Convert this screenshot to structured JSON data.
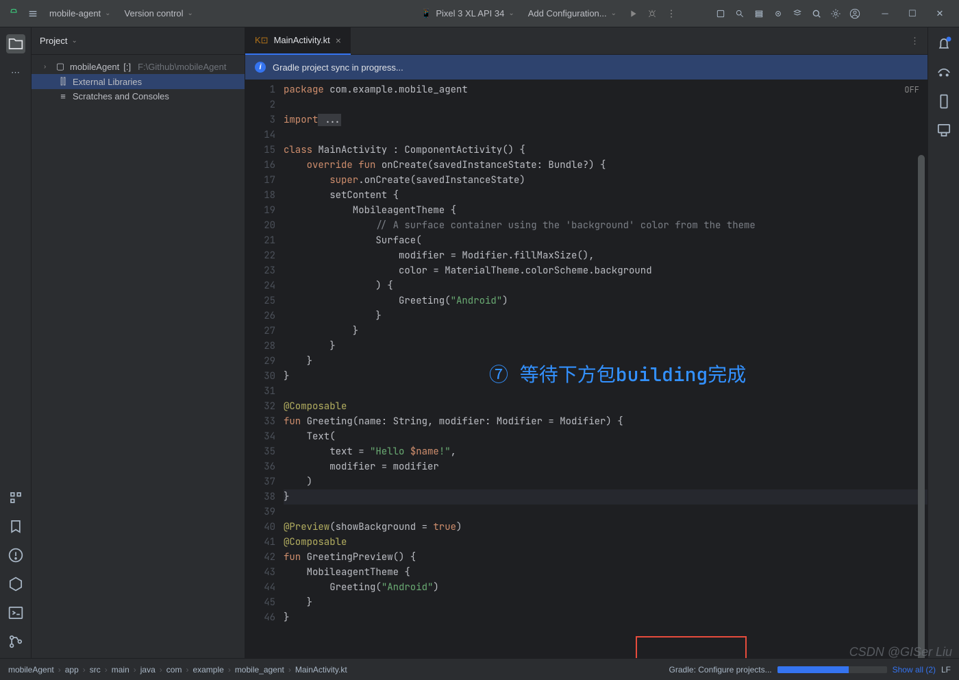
{
  "titlebar": {
    "project_name": "mobile-agent",
    "vcs_label": "Version control",
    "device_label": "Pixel 3 XL API 34",
    "run_config": "Add Configuration..."
  },
  "project_panel": {
    "title": "Project",
    "root": {
      "name": "mobileAgent",
      "branch_suffix": "[:]",
      "path": "F:\\Github\\mobileAgent"
    },
    "external_libs": "External Libraries",
    "scratches": "Scratches and Consoles"
  },
  "editor": {
    "tab_name": "MainActivity.kt",
    "notification": "Gradle project sync in progress...",
    "off_label": "OFF",
    "overlay": "⑦ 等待下方包building完成",
    "line_numbers": [
      1,
      2,
      3,
      14,
      15,
      16,
      17,
      18,
      19,
      20,
      21,
      22,
      23,
      24,
      25,
      26,
      27,
      28,
      29,
      30,
      31,
      32,
      33,
      34,
      35,
      36,
      37,
      38,
      39,
      40,
      41,
      42,
      43,
      44,
      45,
      46
    ],
    "code": {
      "l1": {
        "kw": "package",
        "rest": " com.example.mobile_agent"
      },
      "l3": {
        "kw": "import",
        "rest": " ..."
      },
      "l15": {
        "kw": "class",
        "rest": " MainActivity : ComponentActivity() {"
      },
      "l16": {
        "pre": "    ",
        "kw1": "override ",
        "kw2": "fun",
        "rest": " onCreate(savedInstanceState: Bundle?) {"
      },
      "l17": {
        "pre": "        ",
        "kw": "super",
        "rest": ".onCreate(savedInstanceState)"
      },
      "l18": "        setContent {",
      "l19": "            MobileagentTheme {",
      "l20": {
        "pre": "                ",
        "cmt": "// A surface container using the 'background' color from the theme"
      },
      "l21": "                Surface(",
      "l22": "                    modifier = Modifier.fillMaxSize(),",
      "l23": "                    color = MaterialTheme.colorScheme.background",
      "l24": "                ) {",
      "l25": {
        "pre": "                    Greeting(",
        "str": "\"Android\"",
        "rest": ")"
      },
      "l26": "                }",
      "l27": "            }",
      "l28": "        }",
      "l29": "    }",
      "l30": "}",
      "l32": {
        "ann": "@Composable"
      },
      "l33": {
        "kw": "fun",
        "rest": " Greeting(name: String, modifier: Modifier = Modifier) {"
      },
      "l34": "    Text(",
      "l35": {
        "pre": "        text = ",
        "str": "\"Hello ",
        "tmpl": "$name",
        "str2": "!\"",
        "rest": ","
      },
      "l36": "        modifier = modifier",
      "l37": "    )",
      "l38": "}",
      "l40": {
        "ann": "@Preview",
        "rest": "(showBackground = ",
        "kw": "true",
        "rest2": ")"
      },
      "l41": {
        "ann": "@Composable"
      },
      "l42": {
        "kw": "fun",
        "rest": " GreetingPreview() {"
      },
      "l43": "    MobileagentTheme {",
      "l44": {
        "pre": "        Greeting(",
        "str": "\"Android\"",
        "rest": ")"
      },
      "l45": "    }",
      "l46": "}"
    }
  },
  "statusbar": {
    "breadcrumbs": [
      "mobileAgent",
      "app",
      "src",
      "main",
      "java",
      "com",
      "example",
      "mobile_agent",
      "MainActivity.kt"
    ],
    "task": "Gradle: Configure projects...",
    "show_all": "Show all (2)",
    "lf": "LF"
  },
  "watermark": "CSDN @GISer Liu"
}
